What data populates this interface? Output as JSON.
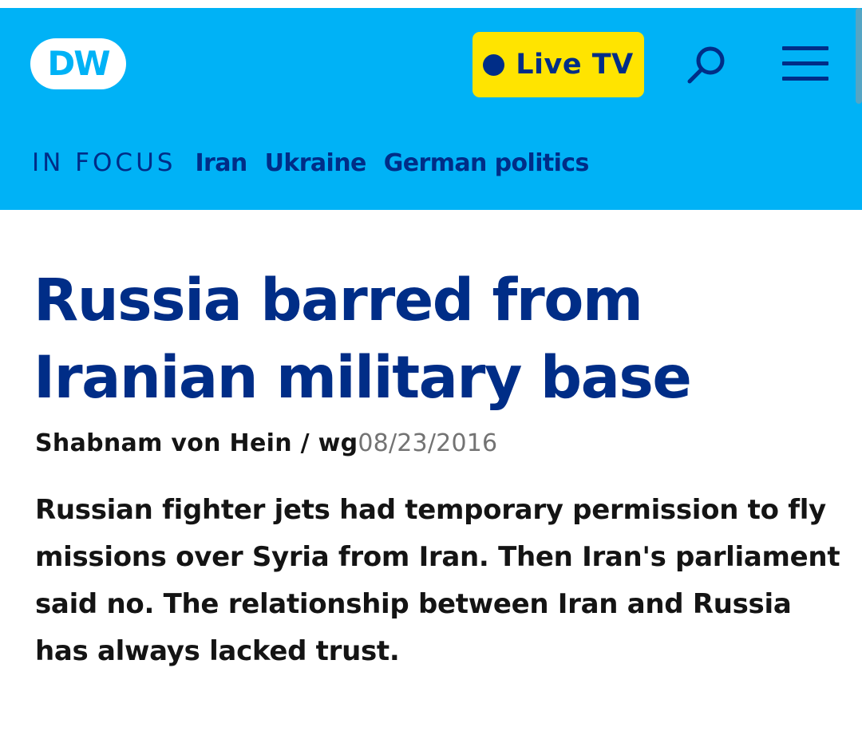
{
  "header": {
    "logo_text": "DW",
    "live_button_label": "Live TV",
    "search_icon": "search-icon",
    "menu_icon": "hamburger-menu-icon",
    "colors": {
      "header_background": "#00b2f6",
      "brand_blue": "#002d87",
      "live_yellow": "#ffe400"
    }
  },
  "in_focus": {
    "label": "IN FOCUS",
    "links": [
      {
        "label": "Iran"
      },
      {
        "label": "Ukraine"
      },
      {
        "label": "German politics"
      }
    ]
  },
  "article": {
    "headline": "Russia barred from Iranian military base",
    "author": "Shabnam von Hein / wg",
    "date": "08/23/2016",
    "teaser": "Russian fighter jets had temporary permission to fly missions over Syria from Iran. Then Iran's parliament said no. The relationship between Iran and Russia has always lacked trust."
  }
}
